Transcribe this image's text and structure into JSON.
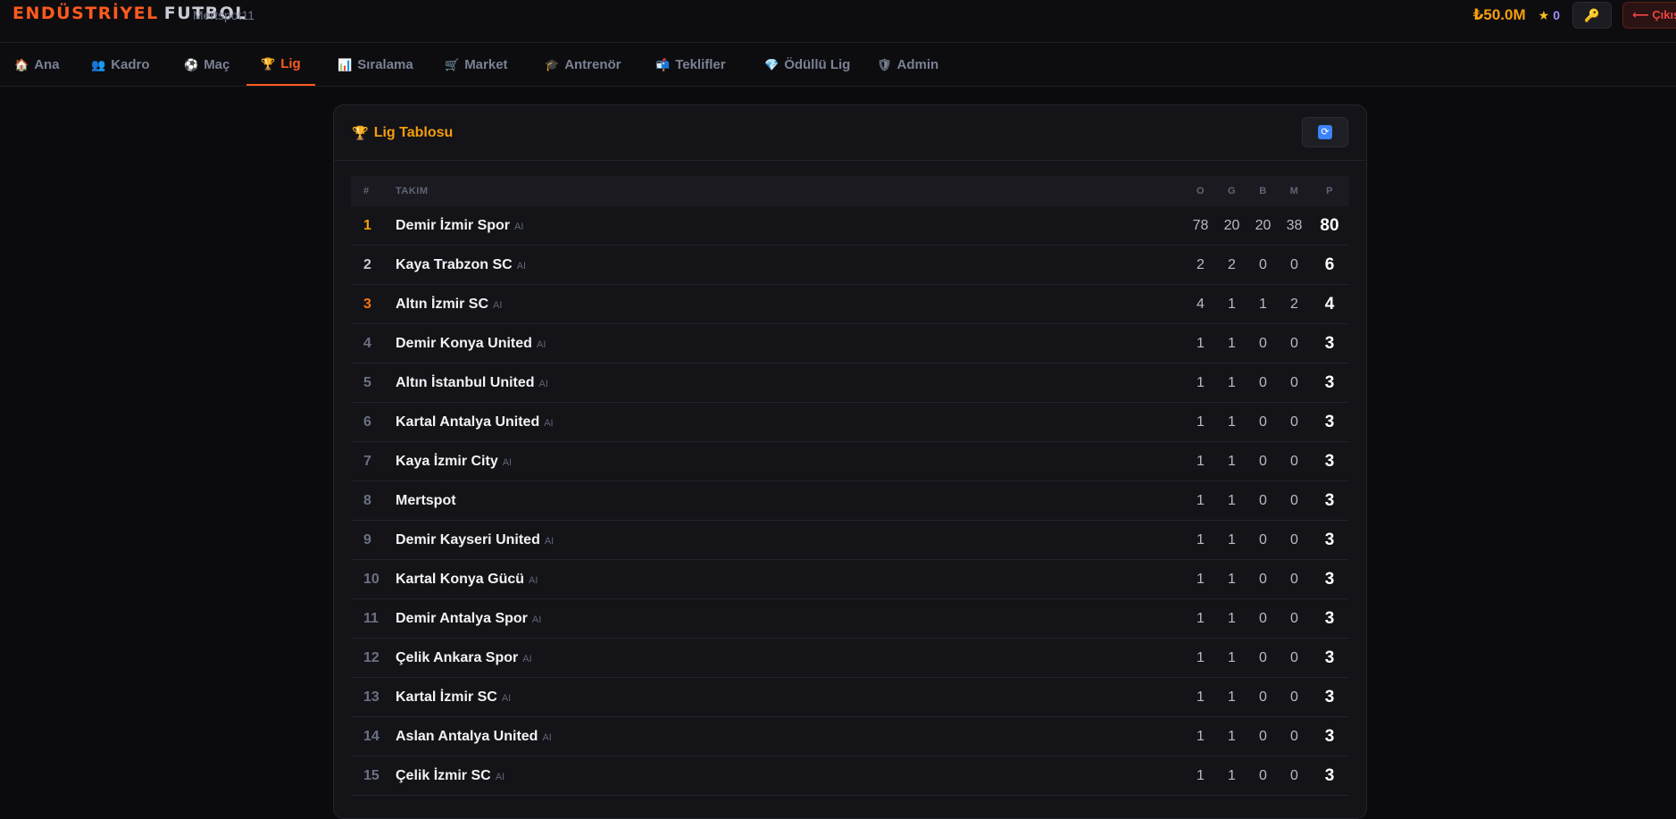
{
  "header": {
    "brand_part1": "ENDÜSTRİYEL",
    "brand_part2": "FUTBOL",
    "username": "Mertspot11",
    "balance": "₺50.0M",
    "stars_icon": "star-icon",
    "stars_count": "0",
    "key_icon": "key-icon",
    "logout_label": "⟵ Çıkış"
  },
  "nav": {
    "tabs": [
      {
        "icon": "🏠",
        "label": "Ana"
      },
      {
        "icon": "👥",
        "label": "Kadro"
      },
      {
        "icon": "⚽",
        "label": "Maç"
      },
      {
        "icon": "🏆",
        "label": "Lig"
      },
      {
        "icon": "📊",
        "label": "Sıralama"
      },
      {
        "icon": "🛒",
        "label": "Market"
      },
      {
        "icon": "🎓",
        "label": "Antrenör"
      },
      {
        "icon": "📬",
        "label": "Teklifler"
      },
      {
        "icon": "💎",
        "label": "Ödüllü Lig"
      },
      {
        "icon": "🛡",
        "label": "Admin"
      }
    ],
    "active": "Lig"
  },
  "league": {
    "title_icon": "🏆",
    "title": "Lig Tablosu",
    "refresh_icon": "🔄",
    "columns": {
      "rank": "#",
      "team": "TAKIM",
      "played": "O",
      "won": "G",
      "drawn": "B",
      "lost": "M",
      "points": "P"
    },
    "ai_tag": "AI",
    "rows": [
      {
        "rank": "1",
        "team": "Demir İzmir Spor",
        "ai": true,
        "o": "78",
        "g": "20",
        "b": "20",
        "m": "38",
        "p": "80"
      },
      {
        "rank": "2",
        "team": "Kaya Trabzon SC",
        "ai": true,
        "o": "2",
        "g": "2",
        "b": "0",
        "m": "0",
        "p": "6"
      },
      {
        "rank": "3",
        "team": "Altın İzmir SC",
        "ai": true,
        "o": "4",
        "g": "1",
        "b": "1",
        "m": "2",
        "p": "4"
      },
      {
        "rank": "4",
        "team": "Demir Konya United",
        "ai": true,
        "o": "1",
        "g": "1",
        "b": "0",
        "m": "0",
        "p": "3"
      },
      {
        "rank": "5",
        "team": "Altın İstanbul United",
        "ai": true,
        "o": "1",
        "g": "1",
        "b": "0",
        "m": "0",
        "p": "3"
      },
      {
        "rank": "6",
        "team": "Kartal Antalya United",
        "ai": true,
        "o": "1",
        "g": "1",
        "b": "0",
        "m": "0",
        "p": "3"
      },
      {
        "rank": "7",
        "team": "Kaya İzmir City",
        "ai": true,
        "o": "1",
        "g": "1",
        "b": "0",
        "m": "0",
        "p": "3"
      },
      {
        "rank": "8",
        "team": "Mertspot",
        "ai": false,
        "o": "1",
        "g": "1",
        "b": "0",
        "m": "0",
        "p": "3"
      },
      {
        "rank": "9",
        "team": "Demir Kayseri United",
        "ai": true,
        "o": "1",
        "g": "1",
        "b": "0",
        "m": "0",
        "p": "3"
      },
      {
        "rank": "10",
        "team": "Kartal Konya Gücü",
        "ai": true,
        "o": "1",
        "g": "1",
        "b": "0",
        "m": "0",
        "p": "3"
      },
      {
        "rank": "11",
        "team": "Demir Antalya Spor",
        "ai": true,
        "o": "1",
        "g": "1",
        "b": "0",
        "m": "0",
        "p": "3"
      },
      {
        "rank": "12",
        "team": "Çelik Ankara Spor",
        "ai": true,
        "o": "1",
        "g": "1",
        "b": "0",
        "m": "0",
        "p": "3"
      },
      {
        "rank": "13",
        "team": "Kartal İzmir SC",
        "ai": true,
        "o": "1",
        "g": "1",
        "b": "0",
        "m": "0",
        "p": "3"
      },
      {
        "rank": "14",
        "team": "Aslan Antalya United",
        "ai": true,
        "o": "1",
        "g": "1",
        "b": "0",
        "m": "0",
        "p": "3"
      },
      {
        "rank": "15",
        "team": "Çelik İzmir SC",
        "ai": true,
        "o": "1",
        "g": "1",
        "b": "0",
        "m": "0",
        "p": "3"
      }
    ]
  }
}
